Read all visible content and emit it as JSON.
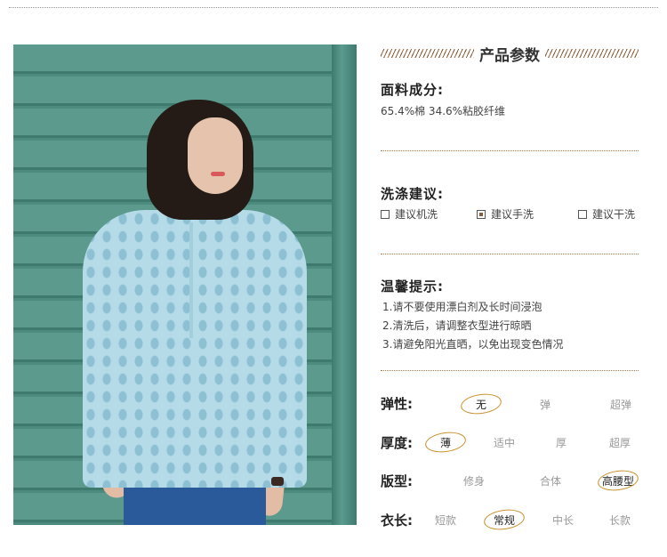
{
  "section_title": "产品参数",
  "fabric": {
    "heading": "面料成分:",
    "value": "65.4%棉 34.6%粘胶纤维"
  },
  "wash": {
    "heading": "洗涤建议:",
    "options": [
      {
        "label": "建议机洗",
        "checked": false
      },
      {
        "label": "建议手洗",
        "checked": true
      },
      {
        "label": "建议干洗",
        "checked": false
      }
    ]
  },
  "tips": {
    "heading": "温馨提示:",
    "items": [
      "1.请不要使用漂白剂及长时间浸泡",
      "2.清洗后，请调整衣型进行晾晒",
      "3.请避免阳光直晒，以免出现变色情况"
    ]
  },
  "attributes": [
    {
      "label": "弹性:",
      "options": [
        "无",
        "弹",
        "超弹"
      ],
      "selected": "无"
    },
    {
      "label": "厚度:",
      "options": [
        "薄",
        "适中",
        "厚",
        "超厚"
      ],
      "selected": "薄"
    },
    {
      "label": "版型:",
      "options": [
        "修身",
        "合体",
        "高腰型"
      ],
      "selected": "高腰型"
    },
    {
      "label": "衣长:",
      "options": [
        "短款",
        "常规",
        "中长",
        "长款"
      ],
      "selected": "常规"
    }
  ],
  "colors": {
    "accent": "#8a5a32",
    "highlight": "#c8912e"
  }
}
